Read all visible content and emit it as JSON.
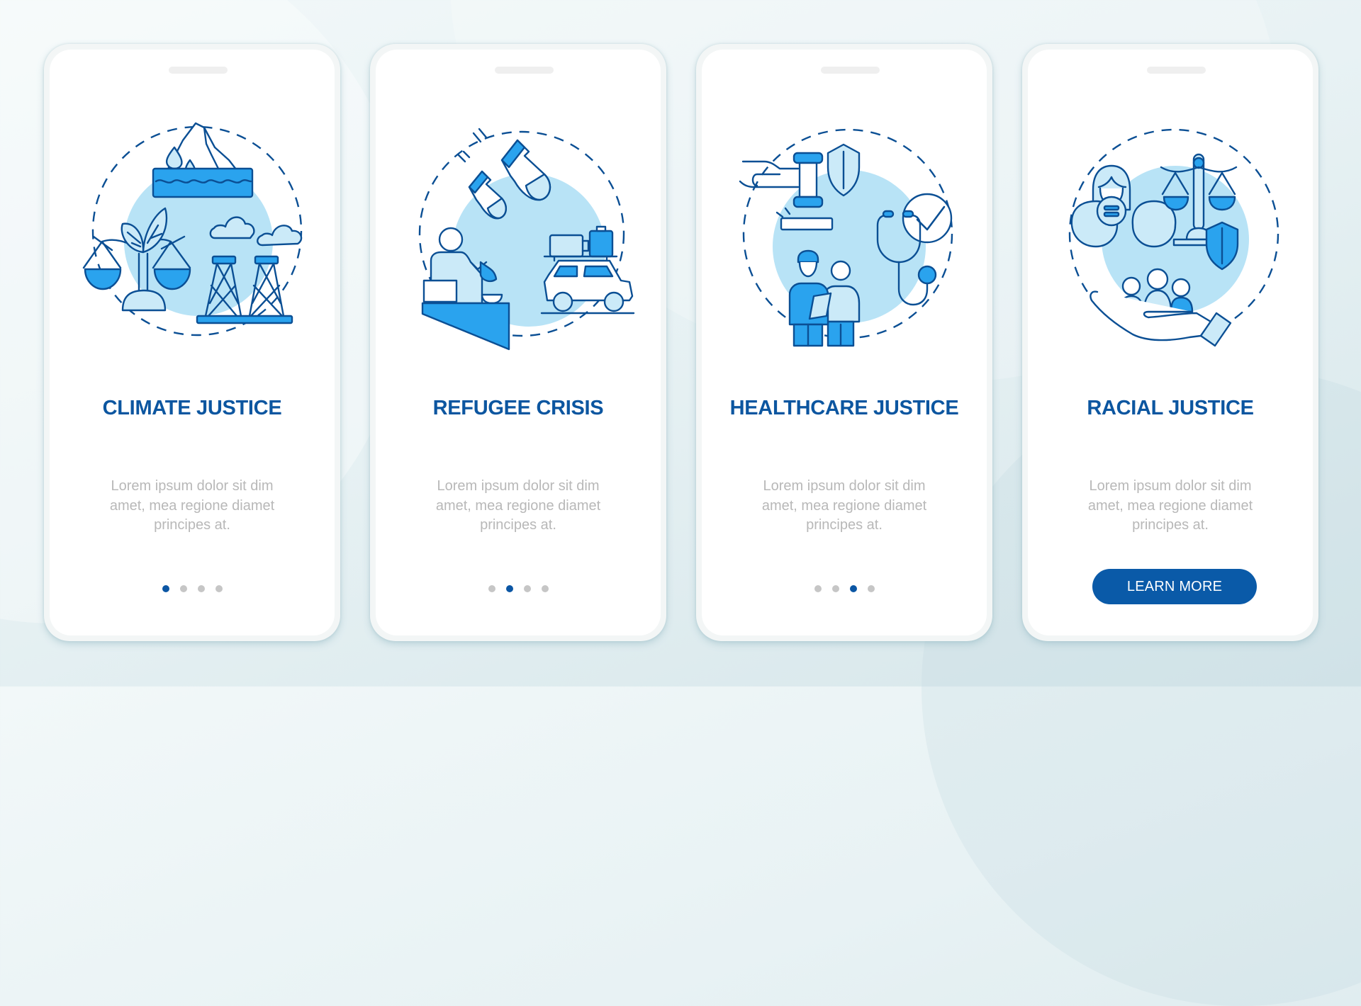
{
  "colors": {
    "outline": "#0b4f94",
    "fill_medium": "#2aa3ee",
    "fill_light": "#cbeaf8",
    "circle_bg": "#b8e3f6",
    "title": "#0c56a0",
    "body_text": "#b8b8b8",
    "dot_active": "#0b56a4",
    "dot_inactive": "#c6c6c6",
    "button_bg": "#0a5aa8"
  },
  "screens": [
    {
      "title": "CLIMATE JUSTICE",
      "icon": "climate-justice-illustration",
      "body": "Lorem ipsum dolor sit dim amet, mea regione diamet principes at.",
      "pagination": {
        "total": 4,
        "active": 1
      }
    },
    {
      "title": "REFUGEE CRISIS",
      "icon": "refugee-crisis-illustration",
      "body": "Lorem ipsum dolor sit dim amet, mea regione diamet principes at.",
      "pagination": {
        "total": 4,
        "active": 2
      }
    },
    {
      "title": "HEALTHCARE JUSTICE",
      "icon": "healthcare-justice-illustration",
      "body": "Lorem ipsum dolor sit dim amet, mea regione diamet principes at.",
      "pagination": {
        "total": 4,
        "active": 3
      }
    },
    {
      "title": "RACIAL JUSTICE",
      "icon": "racial-justice-illustration",
      "body": "Lorem ipsum dolor sit dim amet, mea regione diamet principes at.",
      "button_label": "LEARN MORE"
    }
  ]
}
